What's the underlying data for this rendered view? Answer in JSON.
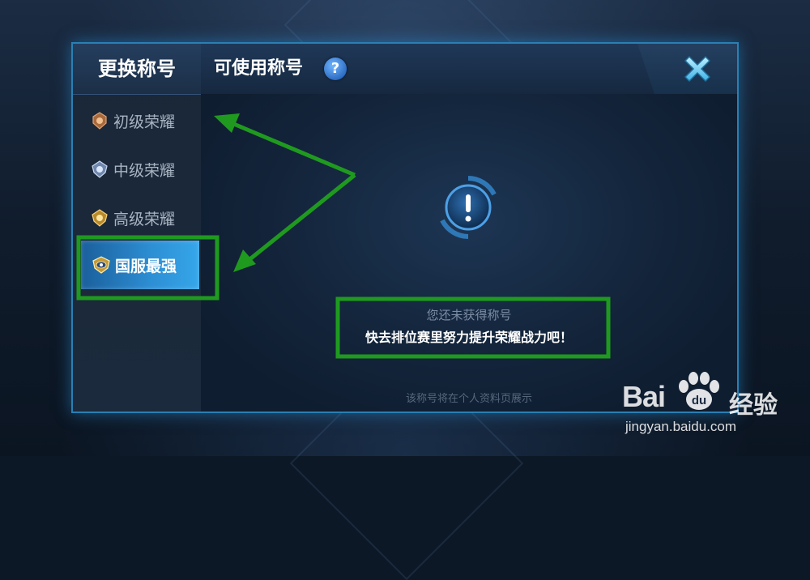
{
  "sidebar": {
    "title": "更换称号",
    "items": [
      {
        "label": "初级荣耀",
        "medal": "bronze-medal-icon",
        "color": "#c58a5a"
      },
      {
        "label": "中级荣耀",
        "medal": "silver-medal-icon",
        "color": "#9fb4d6"
      },
      {
        "label": "高级荣耀",
        "medal": "gold-medal-icon",
        "color": "#e0b04a"
      },
      {
        "label": "国服最强",
        "medal": "king-medal-icon",
        "color": "#f2d57a",
        "active": true
      }
    ]
  },
  "header": {
    "title": "可使用称号",
    "help_label": "?"
  },
  "content": {
    "icon": "alert-icon",
    "message_line1": "您还未获得称号",
    "message_line2": "快去排位赛里努力提升荣耀战力吧！",
    "footer_note": "该称号将在个人资料页展示"
  },
  "annotation_color": "#1f9a1f",
  "watermark": {
    "brand_left": "Bai",
    "brand_right": "经验",
    "url": "jingyan.baidu.com"
  }
}
